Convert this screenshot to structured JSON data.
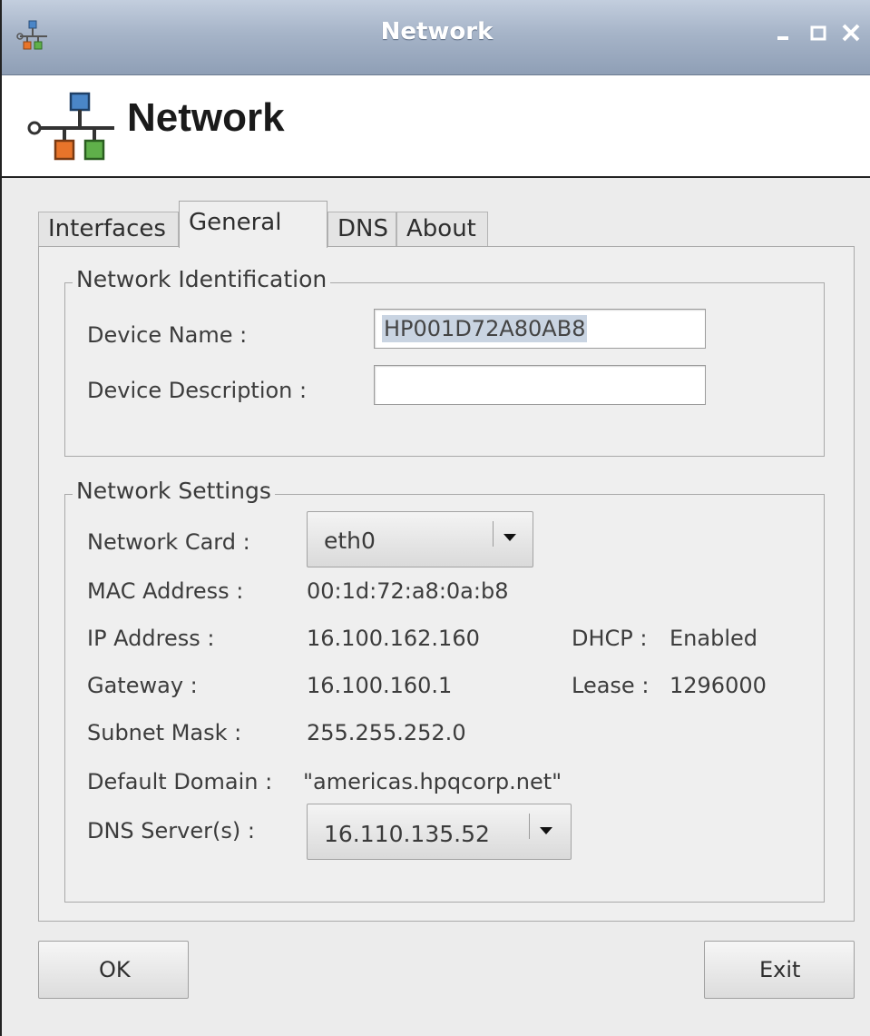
{
  "window": {
    "title": "Network",
    "controls": {
      "minimize": "–",
      "maximize": "□",
      "close": "✕"
    }
  },
  "header": {
    "title": "Network",
    "icon": "network-topology-icon"
  },
  "tabs": [
    {
      "label": "Interfaces",
      "active": false
    },
    {
      "label": "General",
      "active": true
    },
    {
      "label": "DNS",
      "active": false
    },
    {
      "label": "About",
      "active": false
    }
  ],
  "network_identification": {
    "title": "Network Identification",
    "device_name_label": "Device Name :",
    "device_name_value": "HP001D72A80AB8",
    "device_description_label": "Device Description :",
    "device_description_value": ""
  },
  "network_settings": {
    "title": "Network Settings",
    "network_card_label": "Network Card :",
    "network_card_value": "eth0",
    "mac_label": "MAC Address :",
    "mac_value": "00:1d:72:a8:0a:b8",
    "ip_label": "IP Address :",
    "ip_value": "16.100.162.160",
    "dhcp_label": "DHCP :",
    "dhcp_value": "Enabled",
    "gateway_label": "Gateway :",
    "gateway_value": "16.100.160.1",
    "lease_label": "Lease :",
    "lease_value": "1296000",
    "subnet_label": "Subnet Mask :",
    "subnet_value": "255.255.252.0",
    "domain_label": "Default Domain :",
    "domain_value": "\"americas.hpqcorp.net\"",
    "dns_label": "DNS Server(s) :",
    "dns_value": "16.110.135.52"
  },
  "buttons": {
    "ok": "OK",
    "exit": "Exit"
  },
  "colors": {
    "titlebar": "#a6b4c8",
    "icon_blue": "#4a86c8",
    "icon_orange": "#e8742a",
    "icon_green": "#5fb04a",
    "selection": "#c9d4e2"
  }
}
